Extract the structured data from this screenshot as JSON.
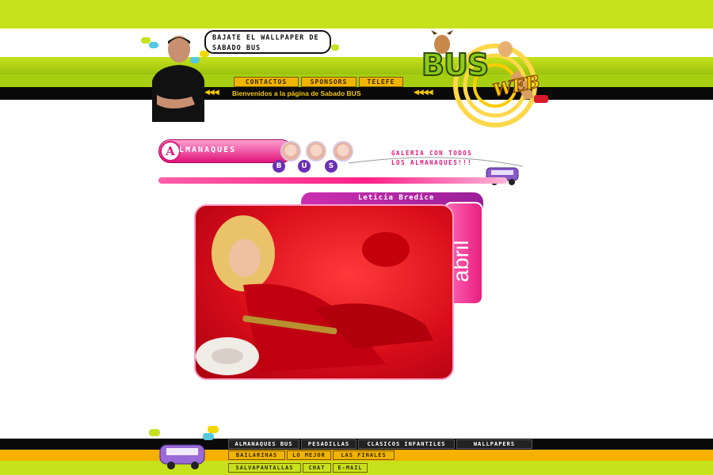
{
  "header": {
    "promo_line1": "BAJATE EL WALLPAPER DE",
    "promo_line2": "SABADO BUS",
    "nav": [
      "CONTACTOS",
      "SPONSORS",
      "TELEFE"
    ],
    "welcome": "Bienvenidos a la página de Sabado BUS",
    "logo_main": "BUS",
    "logo_sub": "WEB"
  },
  "almanaques": {
    "title_initial": "A",
    "title_rest": "LMANAQUES",
    "bus_letters": [
      "B",
      "U",
      "S"
    ],
    "gallery_line1": "GALERIA CON TODOS",
    "gallery_line2": "LOS ALMANAQUES!!!"
  },
  "card": {
    "name": "Leticia Bredice",
    "month": "abril"
  },
  "footer": {
    "row1": [
      "ALMANAQUES BUS",
      "PESADILLAS",
      "CLASICOS INFANTILES",
      "WALLPAPERS"
    ],
    "row2": [
      "BAILARINAS",
      "LO MEJOR",
      "LAS FINALES"
    ],
    "row3": [
      "SALVAPANTALLAS",
      "CHAT",
      "E-MAIL"
    ]
  },
  "colors": {
    "lime": "#c8e41a",
    "pink": "#e0147a",
    "purple": "#9b1f9a",
    "yellow": "#f0b400"
  },
  "icons": [
    "host-figure",
    "bus-icon",
    "logo-characters"
  ]
}
